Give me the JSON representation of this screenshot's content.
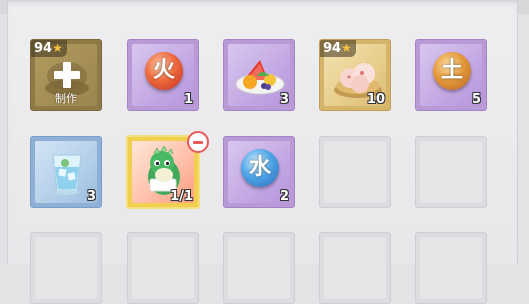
{
  "slots": [
    {
      "id": "craft",
      "level": "94",
      "label": "制作"
    },
    {
      "id": "fire-orb",
      "glyph": "火",
      "count": "1"
    },
    {
      "id": "fruit-plate",
      "count": "3"
    },
    {
      "id": "steamed-buns",
      "level": "94",
      "count": "10"
    },
    {
      "id": "earth-orb",
      "glyph": "土",
      "count": "5"
    },
    {
      "id": "ice-drink",
      "count": "3"
    },
    {
      "id": "dino-character",
      "count": "1/1"
    },
    {
      "id": "water-orb",
      "glyph": "水",
      "count": "2"
    }
  ],
  "colors": {
    "purple_rarity": "#c3a8e3",
    "blue_rarity": "#b4cfe9",
    "gold_rarity": "#e7cd8a",
    "selected_border": "#f1cf4f",
    "remove_red": "#e85a5a"
  }
}
